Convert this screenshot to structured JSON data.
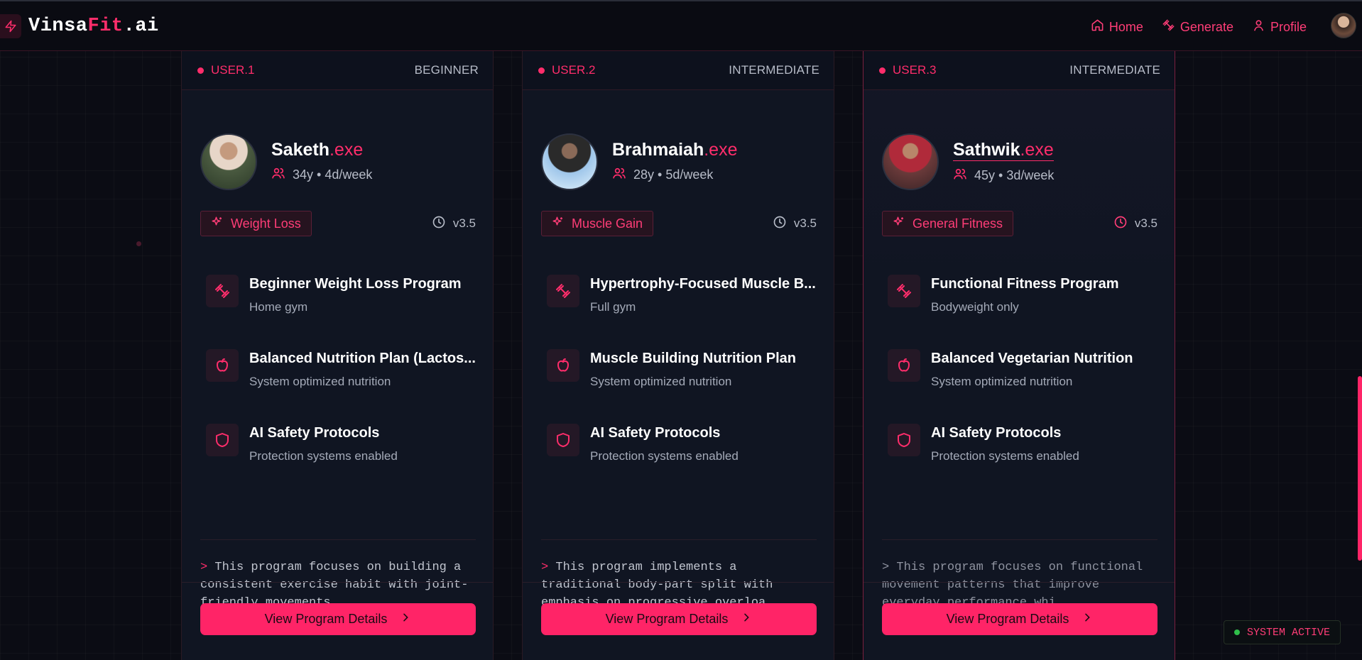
{
  "app": {
    "logo_prefix": "Vinsa",
    "logo_accent": "Fit",
    "logo_suffix": ".ai"
  },
  "nav": {
    "items": [
      {
        "label": "Home",
        "icon": "home-icon"
      },
      {
        "label": "Generate",
        "icon": "dumbbell-icon"
      },
      {
        "label": "Profile",
        "icon": "user-icon"
      }
    ]
  },
  "cards": [
    {
      "user_id": "USER.1",
      "level": "BEGINNER",
      "name": "Saketh",
      "name_suffix": ".exe",
      "meta": "34y • 4d/week",
      "tag": "Weight Loss",
      "version": "v3.5",
      "features": [
        {
          "title": "Beginner Weight Loss Program",
          "sub": "Home gym",
          "icon": "dumbbell-icon"
        },
        {
          "title": "Balanced Nutrition Plan (Lactos...",
          "sub": "System optimized nutrition",
          "icon": "apple-icon"
        },
        {
          "title": "AI Safety Protocols",
          "sub": "Protection systems enabled",
          "icon": "shield-icon"
        }
      ],
      "prompt": ">",
      "description": "This program focuses on building a consistent exercise habit with joint-friendly movements ...",
      "button": "View Program Details"
    },
    {
      "user_id": "USER.2",
      "level": "INTERMEDIATE",
      "name": "Brahmaiah",
      "name_suffix": ".exe",
      "meta": "28y • 5d/week",
      "tag": "Muscle Gain",
      "version": "v3.5",
      "features": [
        {
          "title": "Hypertrophy-Focused Muscle B...",
          "sub": "Full gym",
          "icon": "dumbbell-icon"
        },
        {
          "title": "Muscle Building Nutrition Plan",
          "sub": "System optimized nutrition",
          "icon": "apple-icon"
        },
        {
          "title": "AI Safety Protocols",
          "sub": "Protection systems enabled",
          "icon": "shield-icon"
        }
      ],
      "prompt": ">",
      "description": "This program implements a traditional body-part split with emphasis on progressive overloa ...",
      "button": "View Program Details"
    },
    {
      "user_id": "USER.3",
      "level": "INTERMEDIATE",
      "name": "Sathwik",
      "name_suffix": ".exe",
      "meta": "45y • 3d/week",
      "tag": "General Fitness",
      "version": "v3.5",
      "features": [
        {
          "title": "Functional Fitness Program",
          "sub": "Bodyweight only",
          "icon": "dumbbell-icon"
        },
        {
          "title": "Balanced Vegetarian Nutrition",
          "sub": "System optimized nutrition",
          "icon": "apple-icon"
        },
        {
          "title": "AI Safety Protocols",
          "sub": "Protection systems enabled",
          "icon": "shield-icon"
        }
      ],
      "prompt": ">",
      "description": "This program focuses on functional movement patterns that improve everyday performance whi ...",
      "button": "View Program Details"
    }
  ],
  "status": {
    "label": "SYSTEM ACTIVE"
  },
  "colors": {
    "accent": "#ff2d6b",
    "background": "#0b0c14",
    "card": "#101522",
    "status_ok": "#2fbf4a"
  }
}
